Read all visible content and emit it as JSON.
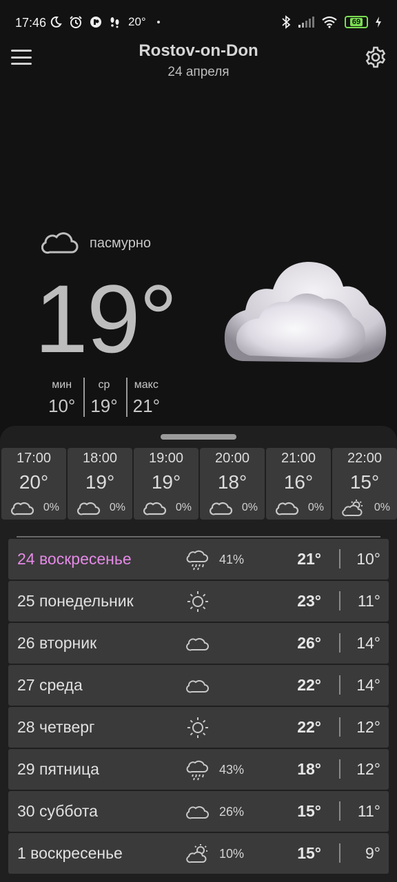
{
  "status_bar": {
    "time": "17:46",
    "temp": "20°",
    "battery": "69",
    "icons": [
      "moon-icon",
      "alarm-icon",
      "app-icon",
      "footsteps-icon",
      "bluetooth-icon",
      "signal-icon",
      "wifi-icon",
      "battery-icon",
      "charging-icon"
    ]
  },
  "header": {
    "city": "Rostov-on-Don",
    "date": "24 апреля"
  },
  "current": {
    "condition": "пасмурно",
    "temp": "19°",
    "min_label": "мин",
    "min_value": "10°",
    "avg_label": "ср",
    "avg_value": "19°",
    "max_label": "макс",
    "max_value": "21°"
  },
  "hourly": [
    {
      "time": "17:00",
      "temp": "20°",
      "icon": "cloud-icon",
      "precip": "0%"
    },
    {
      "time": "18:00",
      "temp": "19°",
      "icon": "cloud-icon",
      "precip": "0%"
    },
    {
      "time": "19:00",
      "temp": "19°",
      "icon": "cloud-icon",
      "precip": "0%"
    },
    {
      "time": "20:00",
      "temp": "18°",
      "icon": "cloud-icon",
      "precip": "0%"
    },
    {
      "time": "21:00",
      "temp": "16°",
      "icon": "cloud-icon",
      "precip": "0%"
    },
    {
      "time": "22:00",
      "temp": "15°",
      "icon": "partly-cloudy-icon",
      "precip": "0%"
    }
  ],
  "daily": [
    {
      "day": "24 воскресенье",
      "icon": "rain-icon",
      "precip": "41%",
      "max": "21°",
      "min": "10°",
      "today": true
    },
    {
      "day": "25 понедельник",
      "icon": "sun-icon",
      "precip": "",
      "max": "23°",
      "min": "11°"
    },
    {
      "day": "26 вторник",
      "icon": "cloud-icon",
      "precip": "",
      "max": "26°",
      "min": "14°"
    },
    {
      "day": "27 среда",
      "icon": "cloud-icon",
      "precip": "",
      "max": "22°",
      "min": "14°"
    },
    {
      "day": "28 четверг",
      "icon": "sun-icon",
      "precip": "",
      "max": "22°",
      "min": "12°"
    },
    {
      "day": "29 пятница",
      "icon": "rain-icon",
      "precip": "43%",
      "max": "18°",
      "min": "12°"
    },
    {
      "day": "30 суббота",
      "icon": "cloud-icon",
      "precip": "26%",
      "max": "15°",
      "min": "11°"
    },
    {
      "day": "1 воскресенье",
      "icon": "partly-cloudy-icon",
      "precip": "10%",
      "max": "15°",
      "min": "9°"
    }
  ],
  "colors": {
    "background": "#121212",
    "sheet": "#1f1f1f",
    "card": "#3a3a3a",
    "today_accent": "#e48ae6",
    "battery": "#7adf52"
  }
}
